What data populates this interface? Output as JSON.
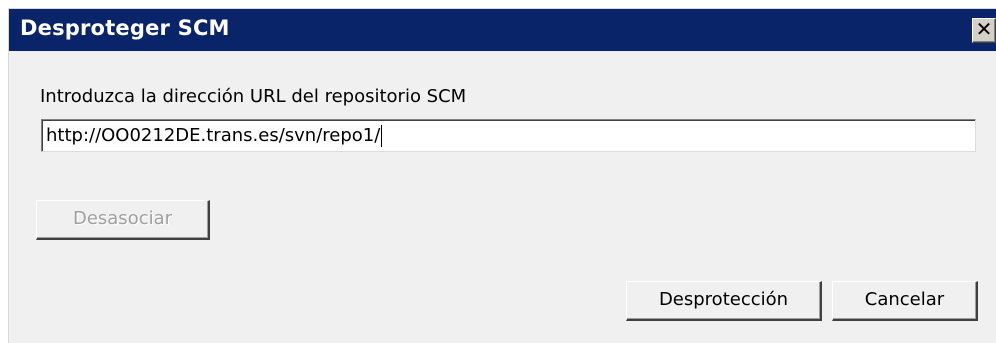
{
  "window": {
    "title": "Desproteger SCM",
    "close_glyph": "✕"
  },
  "form": {
    "prompt_label": "Introduzca la dirección URL del repositorio SCM",
    "url_value": "http://OO0212DE.trans.es/svn/repo1/"
  },
  "buttons": {
    "disassociate_label": "Desasociar",
    "disassociate_enabled": false,
    "unprotect_label": "Desprotección",
    "cancel_label": "Cancelar"
  },
  "colors": {
    "titlebar": "#0a246a",
    "dialog_bg": "#f0f0f0",
    "disabled_text": "#a0a0a0"
  }
}
